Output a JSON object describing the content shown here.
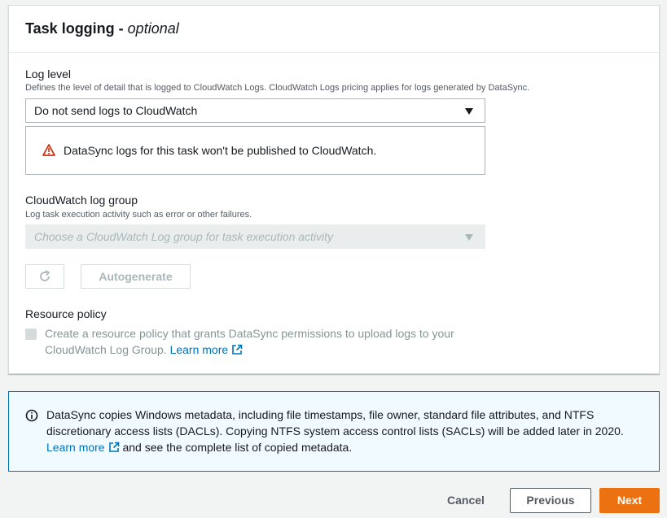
{
  "panel": {
    "title": "Task logging",
    "title_sep": " - ",
    "title_optional": "optional"
  },
  "log_level": {
    "label": "Log level",
    "description": "Defines the level of detail that is logged to CloudWatch Logs. CloudWatch Logs pricing applies for logs generated by DataSync.",
    "selected": "Do not send logs to CloudWatch",
    "warning": "DataSync logs for this task won't be published to CloudWatch."
  },
  "log_group": {
    "label": "CloudWatch log group",
    "description": "Log task execution activity such as error or other failures.",
    "placeholder": "Choose a CloudWatch Log group for task execution activity",
    "autogenerate": "Autogenerate"
  },
  "resource_policy": {
    "label": "Resource policy",
    "checkbox_text": "Create a resource policy that grants DataSync permissions to upload logs to your CloudWatch Log Group.",
    "learn_more": "Learn more"
  },
  "info": {
    "text": "DataSync copies Windows metadata, including file timestamps, file owner, standard file attributes, and NTFS discretionary access lists (DACLs). Copying NTFS system access control lists (SACLs) will be added later in 2020.",
    "learn_more": "Learn more",
    "trailing": "and see the complete list of copied metadata."
  },
  "footer": {
    "cancel": "Cancel",
    "previous": "Previous",
    "next": "Next"
  },
  "colors": {
    "accent": "#ec7211",
    "link": "#0073bb",
    "warning": "#d13212"
  }
}
